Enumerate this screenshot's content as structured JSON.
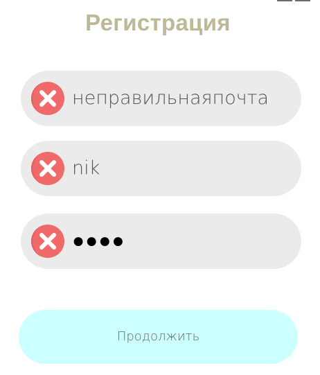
{
  "page": {
    "title": "Регистрация"
  },
  "form": {
    "fields": [
      {
        "name": "email",
        "value": "неправильнаяпочта",
        "status": "error",
        "status_icon": "error-x-icon"
      },
      {
        "name": "username",
        "value": "nik",
        "status": "error",
        "status_icon": "error-x-icon"
      },
      {
        "name": "password",
        "value": "●●●●",
        "status": "error",
        "status_icon": "error-x-icon"
      }
    ],
    "continue_label": "Продолжить"
  },
  "colors": {
    "title": "#bdb895",
    "field_bg": "#ebebeb",
    "error_icon": "#f06a6a",
    "button_bg": "#ccffff"
  }
}
